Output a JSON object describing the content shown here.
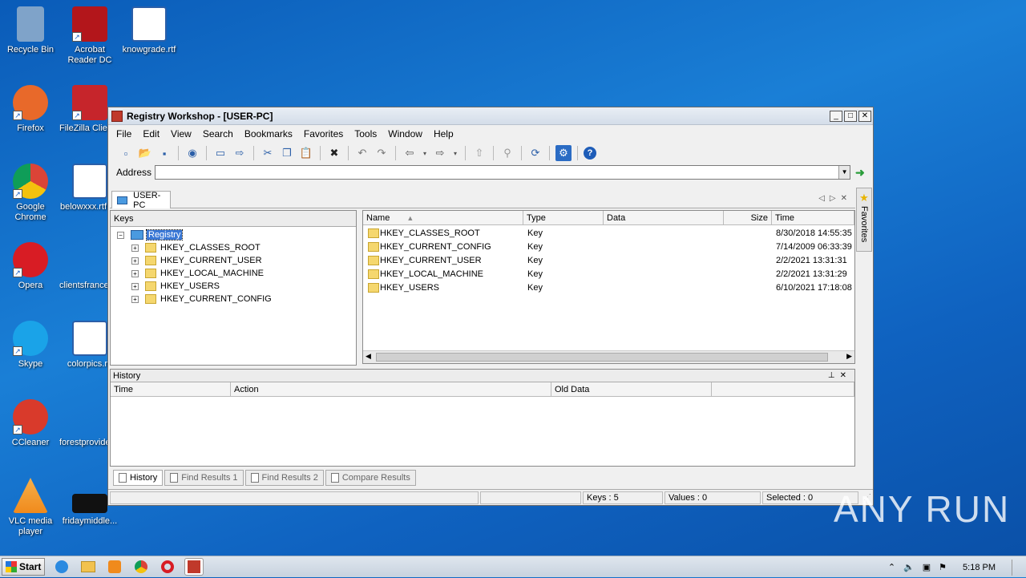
{
  "desktop": {
    "icons": [
      {
        "label": "Recycle Bin",
        "color": "#7fa3c9"
      },
      {
        "label": "Acrobat Reader DC",
        "color": "#b3161b"
      },
      {
        "label": "knowgrade.rtf",
        "color": "#2b5fa8"
      },
      {
        "label": "Firefox",
        "color": "#e8692a"
      },
      {
        "label": "FileZilla Client",
        "color": "#c6252b"
      },
      {
        "label": "Google Chrome",
        "color": "#3aa24a"
      },
      {
        "label": "belowxxx.rtf",
        "color": "#2b5fa8"
      },
      {
        "label": "Opera",
        "color": "#d81c24"
      },
      {
        "label": "clientsfrance",
        "color": "#2b5fa8"
      },
      {
        "label": "Skype",
        "color": "#1aa3e8"
      },
      {
        "label": "colorpics.rtf",
        "color": "#2b5fa8"
      },
      {
        "label": "CCleaner",
        "color": "#d93a2b"
      },
      {
        "label": "forestprovide",
        "color": "#2b5fa8"
      },
      {
        "label": "VLC media player",
        "color": "#f08a1c"
      },
      {
        "label": "fridaymiddle...",
        "color": "#111111"
      }
    ]
  },
  "window": {
    "title": "Registry Workshop - [USER-PC]",
    "menu": [
      "File",
      "Edit",
      "View",
      "Search",
      "Bookmarks",
      "Favorites",
      "Tools",
      "Window",
      "Help"
    ],
    "address_label": "Address",
    "address_value": "",
    "doc_tab": "USER-PC",
    "favorites_label": "Favorites"
  },
  "keys_pane": {
    "header": "Keys",
    "root": "Registry",
    "items": [
      "HKEY_CLASSES_ROOT",
      "HKEY_CURRENT_USER",
      "HKEY_LOCAL_MACHINE",
      "HKEY_USERS",
      "HKEY_CURRENT_CONFIG"
    ]
  },
  "list_pane": {
    "columns": [
      "Name",
      "Type",
      "Data",
      "Size",
      "Time"
    ],
    "rows": [
      {
        "name": "HKEY_CLASSES_ROOT",
        "type": "Key",
        "data": "",
        "size": "",
        "time": "8/30/2018 14:55:35"
      },
      {
        "name": "HKEY_CURRENT_CONFIG",
        "type": "Key",
        "data": "",
        "size": "",
        "time": "7/14/2009 06:33:39"
      },
      {
        "name": "HKEY_CURRENT_USER",
        "type": "Key",
        "data": "",
        "size": "",
        "time": "2/2/2021 13:31:31"
      },
      {
        "name": "HKEY_LOCAL_MACHINE",
        "type": "Key",
        "data": "",
        "size": "",
        "time": "2/2/2021 13:31:29"
      },
      {
        "name": "HKEY_USERS",
        "type": "Key",
        "data": "",
        "size": "",
        "time": "6/10/2021 17:18:08"
      }
    ]
  },
  "history_pane": {
    "title": "History",
    "columns": [
      "Time",
      "Action",
      "Old Data"
    ]
  },
  "bottom_tabs": [
    "History",
    "Find Results 1",
    "Find Results 2",
    "Compare Results"
  ],
  "statusbar": {
    "keys": "Keys : 5",
    "values": "Values : 0",
    "selected": "Selected : 0"
  },
  "taskbar": {
    "start_label": "Start",
    "clock": "5:18 PM"
  },
  "watermark": "ANY RUN"
}
